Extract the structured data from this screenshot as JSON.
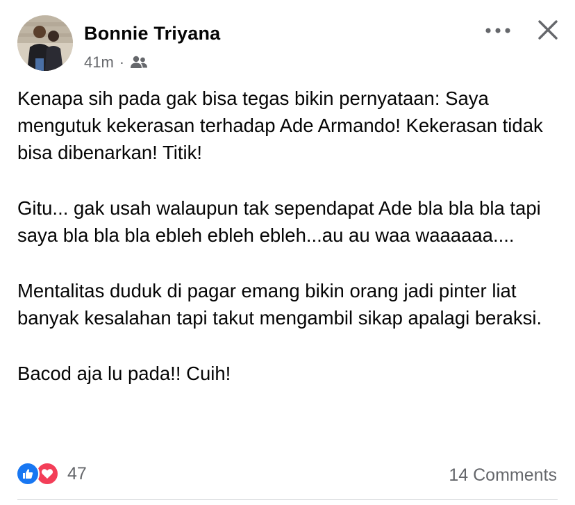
{
  "post": {
    "author_name": "Bonnie Triyana",
    "timestamp": "41m",
    "separator": "·",
    "paragraphs": [
      "Kenapa sih pada gak bisa tegas bikin pernyataan: Saya mengutuk kekerasan terhadap Ade Armando! Kekerasan tidak bisa dibenarkan!  Titik!",
      "Gitu... gak usah walaupun tak sependapat Ade bla bla bla tapi saya bla bla bla ebleh ebleh ebleh...au au waa waaaaaa....",
      "Mentalitas duduk di pagar emang bikin orang jadi pinter liat banyak kesalahan tapi takut mengambil sikap apalagi beraksi.",
      "Bacod aja lu pada!! Cuih!"
    ]
  },
  "footer": {
    "reaction_count": "47",
    "comments_label": "14 Comments"
  },
  "icons": {
    "audience": "friends-icon",
    "more": "more-options-icon",
    "close": "close-icon",
    "like": "like-reaction-icon",
    "love": "love-reaction-icon"
  },
  "colors": {
    "like": "#1877f2",
    "love": "#f33e58",
    "secondary_text": "#65676b"
  }
}
